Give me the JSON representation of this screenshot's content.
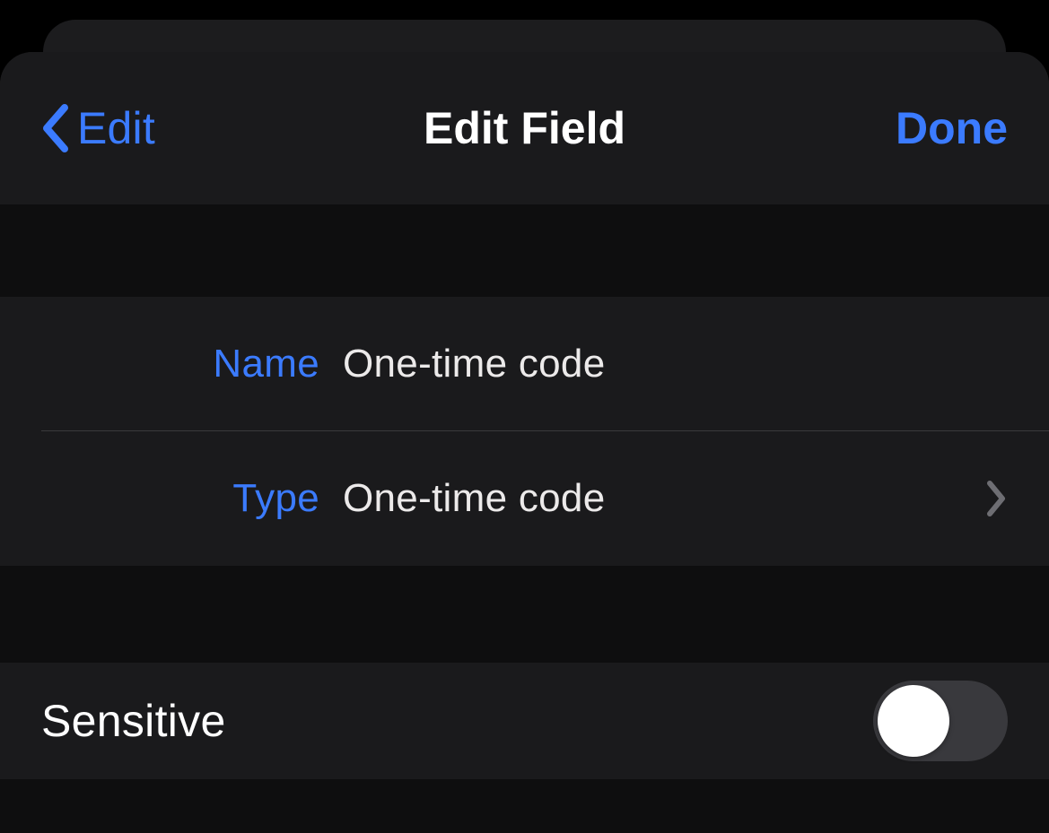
{
  "nav": {
    "back_label": "Edit",
    "title": "Edit Field",
    "done_label": "Done"
  },
  "fields": {
    "name": {
      "label": "Name",
      "value": "One-time code"
    },
    "type": {
      "label": "Type",
      "value": "One-time code"
    }
  },
  "sensitive": {
    "label": "Sensitive",
    "on": false
  },
  "colors": {
    "accent": "#3b7bff",
    "bg_sheet": "#1a1a1c",
    "bg_gap": "#0e0e0f"
  }
}
